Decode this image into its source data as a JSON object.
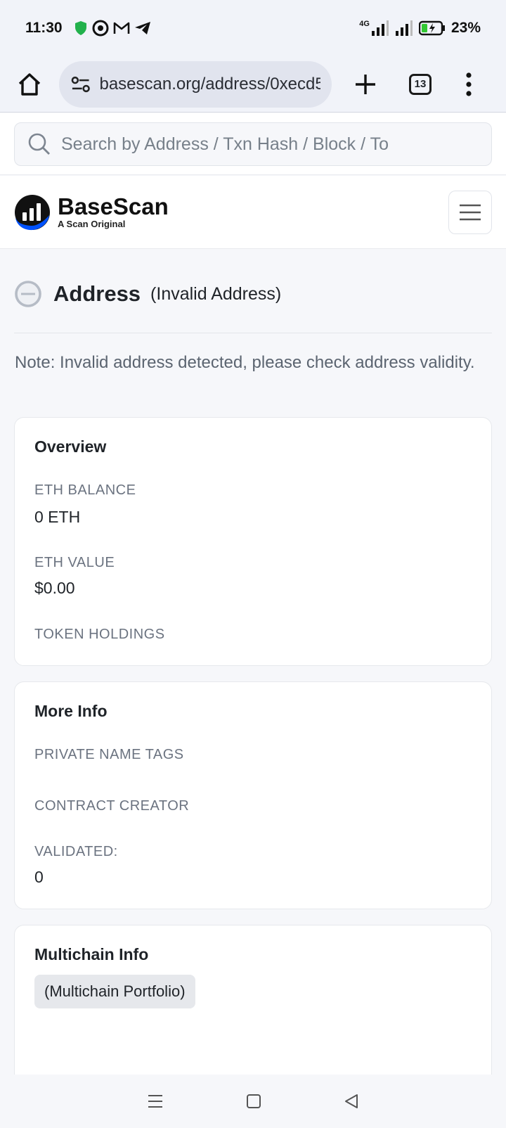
{
  "status_bar": {
    "time": "11:30",
    "network_label": "4G",
    "battery": "23%"
  },
  "browser": {
    "url": "basescan.org/address/0xecd5",
    "tab_count": "13"
  },
  "search": {
    "placeholder": "Search by Address / Txn Hash / Block / To"
  },
  "header": {
    "brand": "BaseScan",
    "tagline": "A Scan Original"
  },
  "page": {
    "title": "Address",
    "subtitle": "(Invalid Address)",
    "note": "Note: Invalid address detected, please check address validity."
  },
  "overview": {
    "heading": "Overview",
    "eth_balance_label": "ETH BALANCE",
    "eth_balance_value": "0 ETH",
    "eth_value_label": "ETH VALUE",
    "eth_value_value": "$0.00",
    "token_holdings_label": "TOKEN HOLDINGS"
  },
  "more_info": {
    "heading": "More Info",
    "private_tags_label": "PRIVATE NAME TAGS",
    "contract_creator_label": "CONTRACT CREATOR",
    "validated_label": "VALIDATED:",
    "validated_value": "0"
  },
  "multichain": {
    "heading": "Multichain Info",
    "portfolio_button": "(Multichain Portfolio)"
  },
  "colors": {
    "brand_blue": "#0052ff",
    "logo_dark": "#111111",
    "shield_green": "#22b14c",
    "battery_green": "#32c832"
  }
}
